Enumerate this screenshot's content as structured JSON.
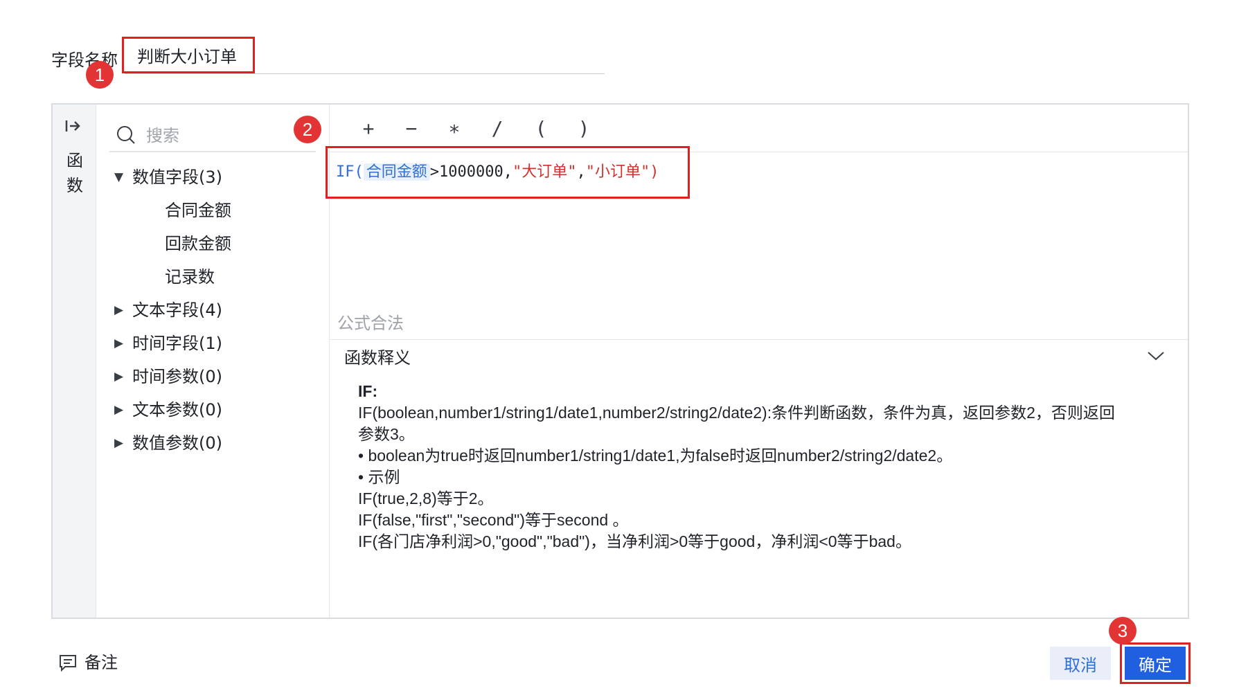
{
  "field": {
    "label": "字段名称",
    "value": "判断大小订单"
  },
  "annotations": {
    "badge1": "1",
    "badge2": "2",
    "badge3": "3"
  },
  "rail": {
    "toggle_icon": "collapse-right-icon",
    "label_line1": "函",
    "label_line2": "数"
  },
  "search": {
    "placeholder": "搜索",
    "icon": "search-icon"
  },
  "tree": {
    "groups": [
      {
        "label": "数值字段(3)",
        "expanded": true,
        "children": [
          "合同金额",
          "回款金额",
          "记录数"
        ]
      },
      {
        "label": "文本字段(4)",
        "expanded": false
      },
      {
        "label": "时间字段(1)",
        "expanded": false
      },
      {
        "label": "时间参数(0)",
        "expanded": false
      },
      {
        "label": "文本参数(0)",
        "expanded": false
      },
      {
        "label": "数值参数(0)",
        "expanded": false
      }
    ]
  },
  "operators": [
    "+",
    "−",
    "∗",
    "/",
    "(",
    ")"
  ],
  "formula": {
    "fn": "IF(",
    "field": "合同金额",
    "cond": ">1000000,",
    "arg1": "\"大订单\"",
    "comma": ",",
    "arg2": "\"小订单\"",
    "close": ")"
  },
  "status_text": "公式合法",
  "help": {
    "title": "函数释义",
    "name": "IF:",
    "lines": [
      "IF(boolean,number1/string1/date1,number2/string2/date2):条件判断函数，条件为真，返回参数2，否则返回",
      "参数3。",
      "• boolean为true时返回number1/string1/date1,为false时返回number2/string2/date2。",
      "• 示例",
      "IF(true,2,8)等于2。",
      "IF(false,\"first\",\"second\")等于second 。",
      "IF(各门店净利润>0,\"good\",\"bad\")，当净利润>0等于good，净利润<0等于bad。"
    ]
  },
  "footer": {
    "note_label": "备注",
    "cancel_label": "取消",
    "ok_label": "确定"
  },
  "colors": {
    "accent": "#1f5fe0",
    "highlight_box": "#e02020",
    "badge": "#e23434",
    "keyword": "#2f6fd6",
    "string": "#d2302d"
  }
}
